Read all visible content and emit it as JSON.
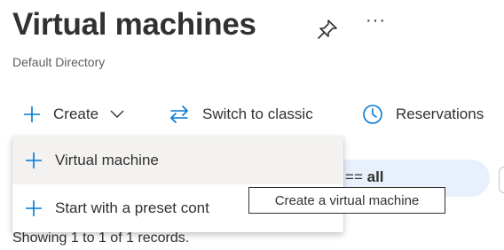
{
  "header": {
    "title": "Virtual machines",
    "subtitle": "Default Directory",
    "pin_icon": "pin-icon",
    "more_label": "···"
  },
  "toolbar": {
    "create_label": "Create",
    "switch_label": "Switch to classic",
    "reservations_label": "Reservations"
  },
  "create_menu": {
    "items": [
      {
        "label": "Virtual machine",
        "icon": "plus-icon"
      },
      {
        "label": "Start with a preset cont",
        "icon": "plus-icon"
      }
    ]
  },
  "tooltip": {
    "text": "Create a virtual machine"
  },
  "filter": {
    "prefix": "ription == ",
    "value": "all"
  },
  "records_text": "Showing 1 to 1 of 1 records.",
  "colors": {
    "accent": "#0078d4",
    "text": "#323130",
    "pill_bg": "#e8f1fb",
    "hover_bg": "#f3f2f1"
  }
}
